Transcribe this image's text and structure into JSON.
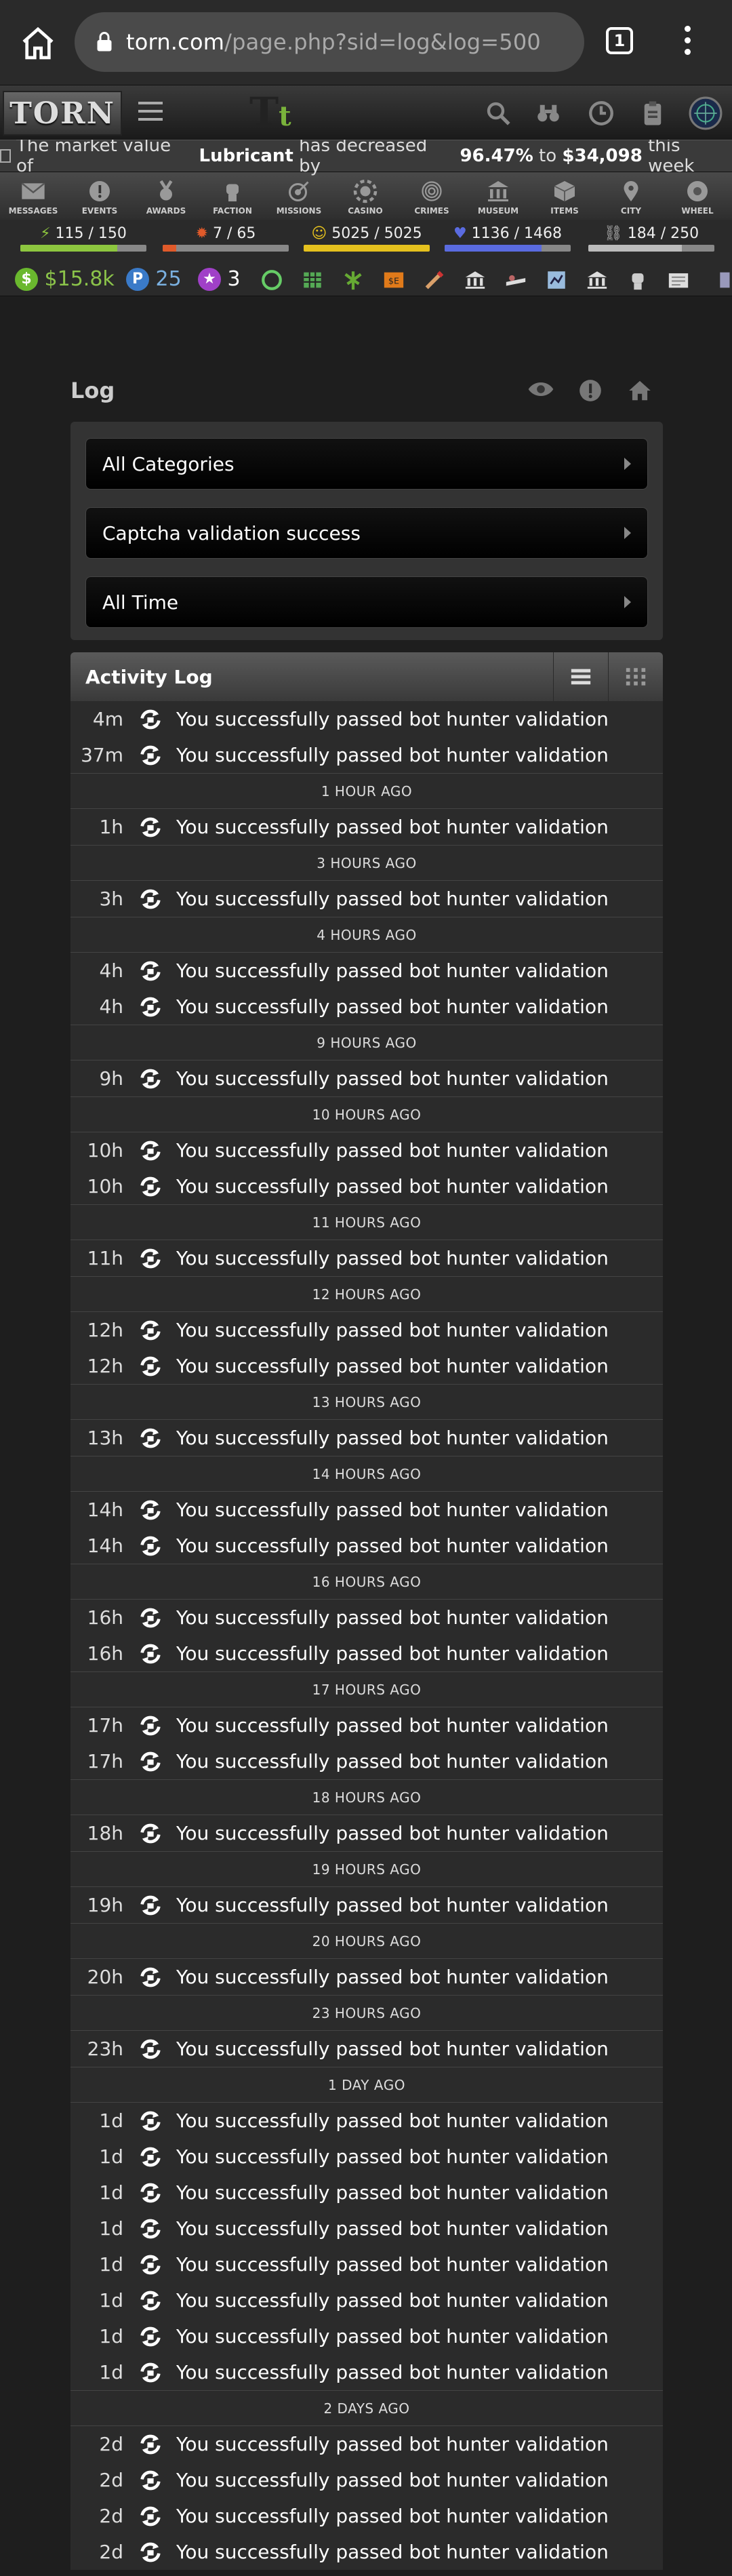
{
  "browser": {
    "url_host": "torn.com",
    "url_path": "/page.php?sid=log&log=500",
    "tab_count": "1"
  },
  "header": {
    "logo_text": "TORN",
    "tt_logo": "T"
  },
  "banner": {
    "prefix": "The market value of",
    "item": "Lubricant",
    "middle": "has decreased by",
    "percent": "96.47%",
    "to": "to",
    "price": "$34,098",
    "suffix": "this week"
  },
  "menu": [
    "MESSAGES",
    "EVENTS",
    "AWARDS",
    "FACTION",
    "MISSIONS",
    "CASINO",
    "CRIMES",
    "MUSEUM",
    "ITEMS",
    "CITY",
    "WHEEL"
  ],
  "bars": [
    {
      "label": "115 / 150",
      "fill": 0.77,
      "color": "#8dc63f"
    },
    {
      "label": "7 / 65",
      "fill": 0.11,
      "color": "#e05a2a"
    },
    {
      "label": "5025 / 5025",
      "fill": 1.0,
      "color": "#e5c11e"
    },
    {
      "label": "1136 / 1468",
      "fill": 0.77,
      "color": "#5a6be0"
    },
    {
      "label": "184 / 250",
      "fill": 0.74,
      "color": "#bbbbbb"
    }
  ],
  "status": {
    "money": "$15.8k",
    "points": "25",
    "merits": "3"
  },
  "log": {
    "title": "Log",
    "filters": [
      "All Categories",
      "Captcha validation success",
      "All Time"
    ],
    "activity_title": "Activity Log"
  },
  "entries": [
    {
      "t": "4m",
      "text": "You successfully passed bot hunter validation"
    },
    {
      "t": "37m",
      "text": "You successfully passed bot hunter validation"
    },
    {
      "sep": "1 HOUR AGO"
    },
    {
      "t": "1h",
      "text": "You successfully passed bot hunter validation"
    },
    {
      "sep": "3 HOURS AGO"
    },
    {
      "t": "3h",
      "text": "You successfully passed bot hunter validation"
    },
    {
      "sep": "4 HOURS AGO"
    },
    {
      "t": "4h",
      "text": "You successfully passed bot hunter validation"
    },
    {
      "t": "4h",
      "text": "You successfully passed bot hunter validation"
    },
    {
      "sep": "9 HOURS AGO"
    },
    {
      "t": "9h",
      "text": "You successfully passed bot hunter validation"
    },
    {
      "sep": "10 HOURS AGO"
    },
    {
      "t": "10h",
      "text": "You successfully passed bot hunter validation"
    },
    {
      "t": "10h",
      "text": "You successfully passed bot hunter validation"
    },
    {
      "sep": "11 HOURS AGO"
    },
    {
      "t": "11h",
      "text": "You successfully passed bot hunter validation"
    },
    {
      "sep": "12 HOURS AGO"
    },
    {
      "t": "12h",
      "text": "You successfully passed bot hunter validation"
    },
    {
      "t": "12h",
      "text": "You successfully passed bot hunter validation"
    },
    {
      "sep": "13 HOURS AGO"
    },
    {
      "t": "13h",
      "text": "You successfully passed bot hunter validation"
    },
    {
      "sep": "14 HOURS AGO"
    },
    {
      "t": "14h",
      "text": "You successfully passed bot hunter validation"
    },
    {
      "t": "14h",
      "text": "You successfully passed bot hunter validation"
    },
    {
      "sep": "16 HOURS AGO"
    },
    {
      "t": "16h",
      "text": "You successfully passed bot hunter validation"
    },
    {
      "t": "16h",
      "text": "You successfully passed bot hunter validation"
    },
    {
      "sep": "17 HOURS AGO"
    },
    {
      "t": "17h",
      "text": "You successfully passed bot hunter validation"
    },
    {
      "t": "17h",
      "text": "You successfully passed bot hunter validation"
    },
    {
      "sep": "18 HOURS AGO"
    },
    {
      "t": "18h",
      "text": "You successfully passed bot hunter validation"
    },
    {
      "sep": "19 HOURS AGO"
    },
    {
      "t": "19h",
      "text": "You successfully passed bot hunter validation"
    },
    {
      "sep": "20 HOURS AGO"
    },
    {
      "t": "20h",
      "text": "You successfully passed bot hunter validation"
    },
    {
      "sep": "23 HOURS AGO"
    },
    {
      "t": "23h",
      "text": "You successfully passed bot hunter validation"
    },
    {
      "sep": "1 DAY AGO"
    },
    {
      "t": "1d",
      "text": "You successfully passed bot hunter validation"
    },
    {
      "t": "1d",
      "text": "You successfully passed bot hunter validation"
    },
    {
      "t": "1d",
      "text": "You successfully passed bot hunter validation"
    },
    {
      "t": "1d",
      "text": "You successfully passed bot hunter validation"
    },
    {
      "t": "1d",
      "text": "You successfully passed bot hunter validation"
    },
    {
      "t": "1d",
      "text": "You successfully passed bot hunter validation"
    },
    {
      "t": "1d",
      "text": "You successfully passed bot hunter validation"
    },
    {
      "t": "1d",
      "text": "You successfully passed bot hunter validation"
    },
    {
      "sep": "2 DAYS AGO"
    },
    {
      "t": "2d",
      "text": "You successfully passed bot hunter validation"
    },
    {
      "t": "2d",
      "text": "You successfully passed bot hunter validation"
    },
    {
      "t": "2d",
      "text": "You successfully passed bot hunter validation"
    },
    {
      "t": "2d",
      "text": "You successfully passed bot hunter validation"
    }
  ]
}
